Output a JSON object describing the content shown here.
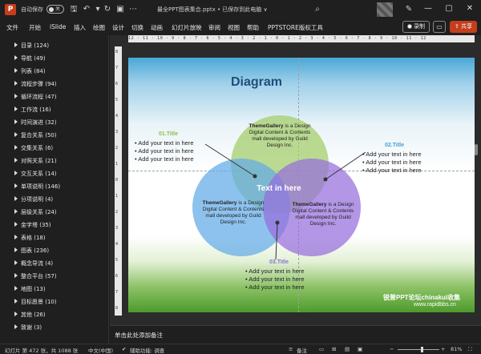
{
  "titlebar": {
    "logo_letter": "P",
    "autosave_label": "自动保存",
    "autosave_state": "关",
    "document_title": "最全PPT图表集合.pptx • 已保存到此电脑 ∨",
    "icons": [
      "save-icon",
      "undo-icon",
      "redo-icon",
      "slideshow-icon",
      "more-icon",
      "search-icon",
      "pen-icon",
      "minimize-icon",
      "maximize-icon",
      "close-icon"
    ]
  },
  "menubar": {
    "items": [
      "文件",
      "开始",
      "iSlide",
      "插入",
      "绘图",
      "设计",
      "切换",
      "动画",
      "幻灯片放映",
      "审阅",
      "视图",
      "帮助",
      "PPTSTORE版权工具"
    ],
    "record_label": "录制",
    "share_label": "共享"
  },
  "sidebar": {
    "items": [
      "目录 (124)",
      "导航 (49)",
      "列表 (84)",
      "流程步骤 (94)",
      "循环流程 (47)",
      "工作流 (16)",
      "时间演进 (32)",
      "复合关系 (50)",
      "交集关系 (6)",
      "对照关系 (21)",
      "交互关系 (14)",
      "单项说明 (146)",
      "分项说明 (4)",
      "层级关系 (24)",
      "金字塔 (35)",
      "表格 (18)",
      "图表 (236)",
      "概念导流 (4)",
      "整合平台 (57)",
      "地图 (13)",
      "目标愿景 (10)",
      "其他 (26)",
      "致谢 (3)"
    ]
  },
  "ruler": {
    "h_marks": "12 · 11 · 10 · 9 · 8 · 7 · 6 · 5 · 4 · 3 · 2 · 1 · 0 · 1 · 2 · 3 · 4 · 5 · 6 · 7 · 8 · 9 · 10 · 11 · 12",
    "v_marks": [
      "8",
      "7",
      "6",
      "5",
      "4",
      "3",
      "2",
      "1",
      "0",
      "1",
      "2",
      "3",
      "4",
      "5",
      "6",
      "7",
      "8"
    ]
  },
  "slide": {
    "title": "Diagram",
    "center_label": "Text in here",
    "circle_text_bold": "ThemeGallery",
    "circle_text_rest": " is a Design Digital Content & Contents mall developed by Guild Design Inc.",
    "sections": [
      {
        "title": "01.Title",
        "color": "#8cc04a",
        "bullets": [
          "• Add your text in here",
          "• Add your text in here",
          "• Add your text in here"
        ]
      },
      {
        "title": "02.Title",
        "color": "#4a9bd6",
        "bullets": [
          "• Add your text in here",
          "• Add your text in here",
          "• Add your text in here"
        ]
      },
      {
        "title": "03.Title",
        "color": "#8a6fd4",
        "bullets": [
          "• Add your text in here",
          "• Add your text in here",
          "• Add your text in here"
        ]
      }
    ],
    "watermark_line1": "锐普PPT论坛chinakui收集",
    "watermark_line2": "www.rapidbbs.cn",
    "colors": {
      "green": "#a6ce6c",
      "blue": "#63aae8",
      "purple": "#966edc",
      "title": "#1f4e79"
    }
  },
  "notes": {
    "placeholder": "单击此处添加备注"
  },
  "statusbar": {
    "slide_info": "幻灯片 第 472 张，共 1088 张",
    "language": "中文(中国)",
    "accessibility": "辅助功能: 调查",
    "notes_label": "备注",
    "zoom": "81%"
  }
}
